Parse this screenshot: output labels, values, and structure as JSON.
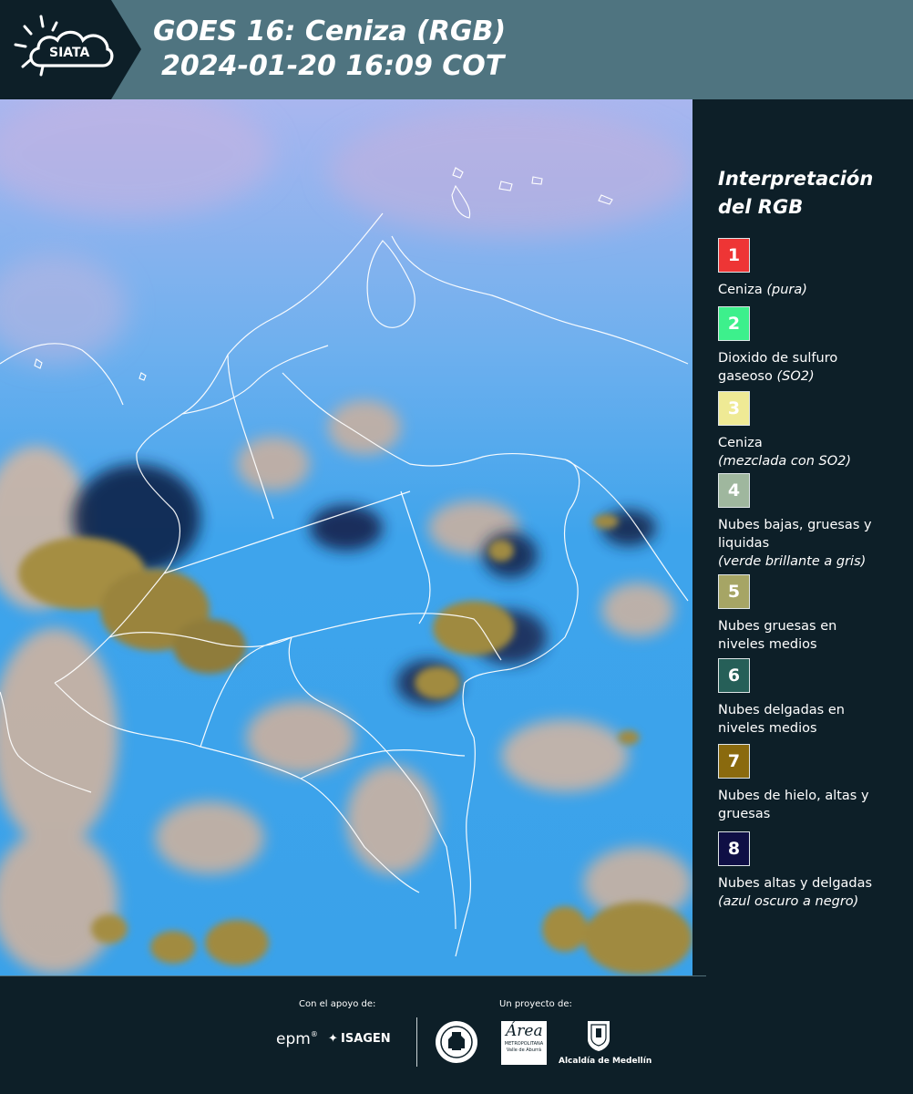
{
  "header": {
    "logo_text": "SIATA",
    "title_line1": "GOES 16: Ceniza (RGB)",
    "title_line2": "2024-01-20 16:09 COT"
  },
  "legend": {
    "title_line1": "Interpretación",
    "title_line2": "del RGB",
    "items": [
      {
        "number": "1",
        "color": "#ee3535",
        "label": "Ceniza",
        "note": "(pura)",
        "label2": ""
      },
      {
        "number": "2",
        "color": "#3df08c",
        "label": "Dioxido de sulfuro",
        "label2": "gaseoso",
        "note": "(SO2)"
      },
      {
        "number": "3",
        "color": "#efea95",
        "label": "Ceniza",
        "label2": "",
        "note": "(mezclada con SO2)"
      },
      {
        "number": "4",
        "color": "#9fb79e",
        "label": "Nubes bajas, gruesas y",
        "label2": "liquidas",
        "note": "(verde brillante a gris)"
      },
      {
        "number": "5",
        "color": "#a6a565",
        "label": "Nubes gruesas en",
        "label2": "niveles medios",
        "note": ""
      },
      {
        "number": "6",
        "color": "#265f58",
        "label": "Nubes delgadas en",
        "label2": "niveles medios",
        "note": ""
      },
      {
        "number": "7",
        "color": "#8a6a0e",
        "label": "Nubes de hielo, altas y",
        "label2": "gruesas",
        "note": ""
      },
      {
        "number": "8",
        "color": "#0f0f45",
        "label": "Nubes altas y delgadas",
        "label2": "",
        "note": "(azul oscuro a negro)"
      }
    ]
  },
  "footer": {
    "support_label": "Con el apoyo de:",
    "project_label": "Un proyecto de:",
    "logo_epm": "epm",
    "logo_isagen": "ISAGEN",
    "logo_metro": "Área",
    "logo_metro_sub1": "METROPOLITANA",
    "logo_metro_sub2": "Valle de Aburrá",
    "logo_medellin": "Alcaldía de Medellín"
  }
}
